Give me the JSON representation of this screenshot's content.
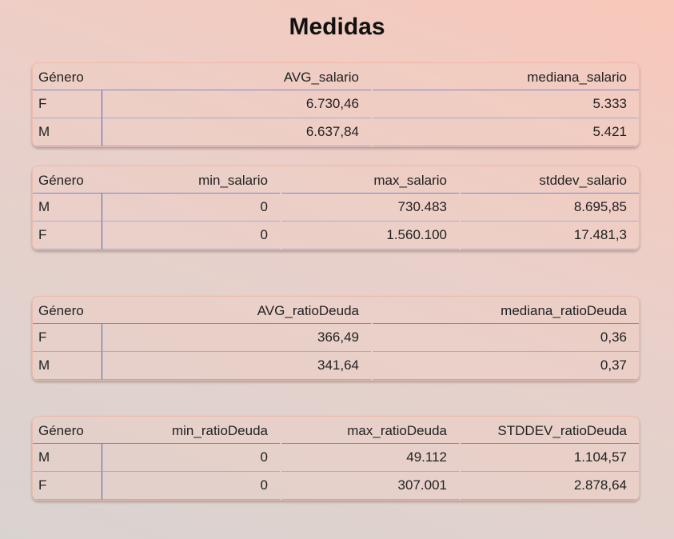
{
  "title": "Medidas",
  "tables": [
    {
      "headers": [
        "Género",
        "AVG_salario",
        "mediana_salario"
      ],
      "rows": [
        [
          "F",
          "6.730,46",
          "5.333"
        ],
        [
          "M",
          "6.637,84",
          "5.421"
        ]
      ]
    },
    {
      "headers": [
        "Género",
        "min_salario",
        "max_salario",
        "stddev_salario"
      ],
      "rows": [
        [
          "M",
          "0",
          "730.483",
          "8.695,85"
        ],
        [
          "F",
          "0",
          "1.560.100",
          "17.481,3"
        ]
      ]
    },
    {
      "headers": [
        "Género",
        "AVG_ratioDeuda",
        "mediana_ratioDeuda"
      ],
      "rows": [
        [
          "F",
          "366,49",
          "0,36"
        ],
        [
          "M",
          "341,64",
          "0,37"
        ]
      ]
    },
    {
      "headers": [
        "Género",
        "min_ratioDeuda",
        "max_ratioDeuda",
        "STDDEV_ratioDeuda"
      ],
      "rows": [
        [
          "M",
          "0",
          "49.112",
          "1.104,57"
        ],
        [
          "F",
          "0",
          "307.001",
          "2.878,64"
        ]
      ]
    }
  ]
}
